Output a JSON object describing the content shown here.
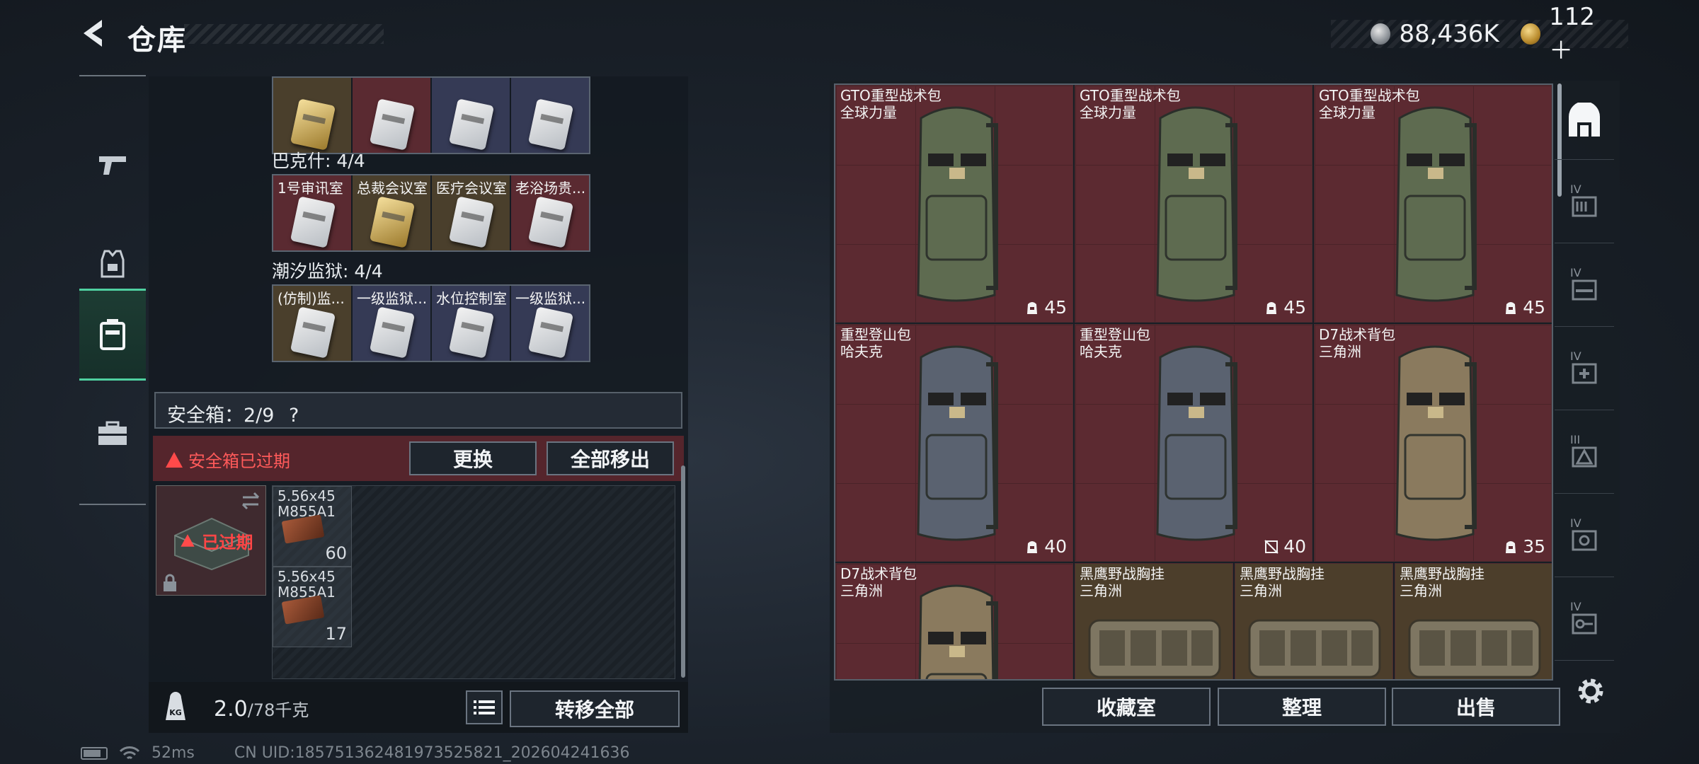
{
  "header": {
    "title": "仓库",
    "currency": [
      {
        "icon": "silver-coin-icon",
        "value": "88,436K"
      },
      {
        "icon": "gold-coin-icon",
        "value": "112＋"
      }
    ]
  },
  "categories": [
    {
      "name": "weapon",
      "icon": "pistol-icon"
    },
    {
      "name": "equipment",
      "icon": "armor-vest-icon"
    },
    {
      "name": "storage",
      "icon": "case-icon",
      "active": true
    },
    {
      "name": "items",
      "icon": "toolbox-icon"
    }
  ],
  "left_panel": {
    "top_row": [
      {
        "name": "",
        "style": "gold"
      },
      {
        "name": "",
        "style": "red"
      },
      {
        "name": "",
        "style": "blue"
      },
      {
        "name": "",
        "style": "blue"
      }
    ],
    "groups": [
      {
        "label": "巴克什: 4/4",
        "cards": [
          {
            "name": "1号审讯室",
            "style": "red"
          },
          {
            "name": "总裁会议室",
            "style": "gold"
          },
          {
            "name": "医疗会议室",
            "style": "gold"
          },
          {
            "name": "老浴场贵...",
            "style": "red"
          }
        ]
      },
      {
        "label": "潮汐监狱: 4/4",
        "cards": [
          {
            "name": "(仿制)监...",
            "style": "gold"
          },
          {
            "name": "一级监狱...",
            "style": "blue"
          },
          {
            "name": "水位控制室",
            "style": "blue"
          },
          {
            "name": "一级监狱...",
            "style": "blue"
          }
        ]
      }
    ],
    "safebox": {
      "label": "安全箱：2/9",
      "help": "?",
      "expired_text": "安全箱已过期",
      "replace_label": "更换",
      "remove_all_label": "全部移出",
      "status_label": "已过期",
      "ammo": [
        {
          "name": "5.56x45 M855A1",
          "count": "60"
        },
        {
          "name": "5.56x45 M855A1",
          "count": "17"
        }
      ]
    },
    "weight": {
      "current": "2.0",
      "max": "/78千克",
      "icon_text": "KG"
    },
    "transfer_all_label": "转移全部"
  },
  "right_panel": {
    "items": [
      {
        "name": "GTO重型战术包",
        "sub": "全球力量",
        "count": "45",
        "kind": "backpack",
        "color": "#5e6b50"
      },
      {
        "name": "GTO重型战术包",
        "sub": "全球力量",
        "count": "45",
        "kind": "backpack",
        "color": "#5e6b50"
      },
      {
        "name": "GTO重型战术包",
        "sub": "全球力量",
        "count": "45",
        "kind": "backpack",
        "color": "#5e6b50"
      },
      {
        "name": "重型登山包",
        "sub": "哈夫克",
        "count": "40",
        "kind": "backpack",
        "color": "#5a6270"
      },
      {
        "name": "重型登山包",
        "sub": "哈夫克",
        "count": "40",
        "kind": "backpack",
        "color": "#5a6270",
        "no_trade": true
      },
      {
        "name": "D7战术背包",
        "sub": "三角洲",
        "count": "35",
        "kind": "backpack",
        "color": "#8a7a5e"
      },
      {
        "name": "D7战术背包",
        "sub": "三角洲",
        "count": "",
        "kind": "backpack",
        "color": "#8a7a5e"
      },
      {
        "name": "黑鹰野战胸挂",
        "sub": "三角洲",
        "count": "",
        "kind": "vest",
        "color": "#7e7662"
      },
      {
        "name": "黑鹰野战胸挂",
        "sub": "三角洲",
        "count": "",
        "kind": "vest",
        "color": "#7e7662"
      },
      {
        "name": "黑鹰野战胸挂",
        "sub": "三角洲",
        "count": "",
        "kind": "vest",
        "color": "#7e7662"
      }
    ],
    "buttons": {
      "collection": "收藏室",
      "organize": "整理",
      "sell": "出售"
    }
  },
  "tools": [
    {
      "tier": "",
      "icon": "safehouse-icon"
    },
    {
      "tier": "IV",
      "icon": "stash-case-icon"
    },
    {
      "tier": "IV",
      "icon": "weapon-case-icon"
    },
    {
      "tier": "IV",
      "icon": "medical-case-icon"
    },
    {
      "tier": "III",
      "icon": "ammo-case-icon"
    },
    {
      "tier": "IV",
      "icon": "keycard-case-icon"
    },
    {
      "tier": "IV",
      "icon": "key-case-icon"
    }
  ],
  "footer": {
    "ping": "52ms",
    "uid": "CN UID:1857513624819735258​21_202604241636"
  }
}
